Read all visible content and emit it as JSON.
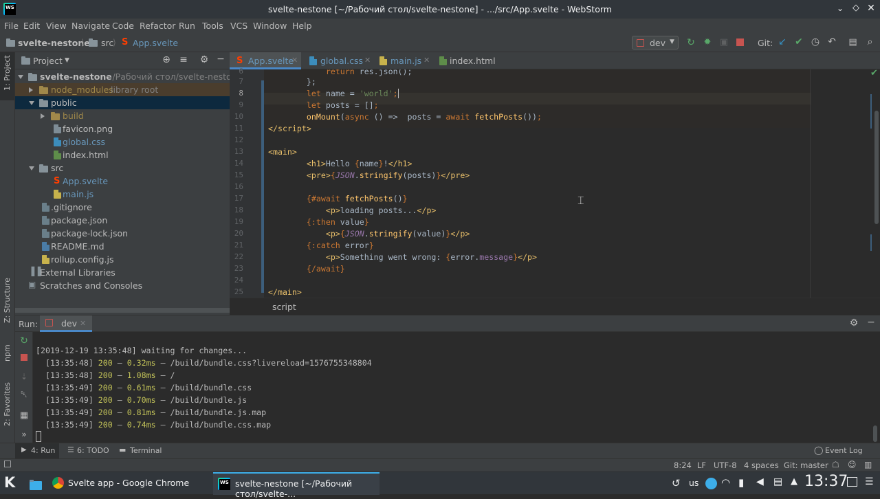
{
  "window": {
    "title": "svelte-nestone [~/Рабочий стол/svelte-nestone] - .../src/App.svelte - WebStorm"
  },
  "menu": [
    "File",
    "Edit",
    "View",
    "Navigate",
    "Code",
    "Refactor",
    "Run",
    "Tools",
    "VCS",
    "Window",
    "Help"
  ],
  "navbar": {
    "crumbs": [
      "svelte-nestone",
      "src",
      "App.svelte"
    ],
    "run_config": "dev",
    "git_label": "Git:"
  },
  "left_strip": {
    "project": "1: Project",
    "structure": "Z: Structure",
    "npm": "npm",
    "favorites": "2: Favorites"
  },
  "project_panel": {
    "title": "Project",
    "tree": [
      {
        "label": "svelte-nestone",
        "suffix": "~/Рабочий стол/svelte-nestone",
        "kind": "folder",
        "icon": "folder-icon"
      },
      {
        "label": "node_modules",
        "suffix": "library root",
        "kind": "folder",
        "icon": "folder-icon"
      },
      {
        "label": "public",
        "kind": "folder",
        "icon": "folder-icon"
      },
      {
        "label": "build",
        "kind": "folder",
        "icon": "folder-icon"
      },
      {
        "label": "favicon.png",
        "kind": "file",
        "icon": "image-file-icon"
      },
      {
        "label": "global.css",
        "kind": "file",
        "icon": "css-file-icon"
      },
      {
        "label": "index.html",
        "kind": "file",
        "icon": "html-file-icon"
      },
      {
        "label": "src",
        "kind": "folder",
        "icon": "folder-icon"
      },
      {
        "label": "App.svelte",
        "kind": "file",
        "icon": "svelte-file-icon"
      },
      {
        "label": "main.js",
        "kind": "file",
        "icon": "js-file-icon"
      },
      {
        "label": ".gitignore",
        "kind": "file",
        "icon": "text-file-icon"
      },
      {
        "label": "package.json",
        "kind": "file",
        "icon": "json-file-icon"
      },
      {
        "label": "package-lock.json",
        "kind": "file",
        "icon": "json-file-icon"
      },
      {
        "label": "README.md",
        "kind": "file",
        "icon": "md-file-icon"
      },
      {
        "label": "rollup.config.js",
        "kind": "file",
        "icon": "js-file-icon"
      },
      {
        "label": "External Libraries",
        "kind": "special",
        "icon": "library-icon"
      },
      {
        "label": "Scratches and Consoles",
        "kind": "special",
        "icon": "scratches-icon"
      }
    ]
  },
  "editor": {
    "tabs": [
      {
        "label": "App.svelte",
        "icon": "svelte-file-icon",
        "active": true
      },
      {
        "label": "global.css",
        "icon": "css-file-icon"
      },
      {
        "label": "main.js",
        "icon": "js-file-icon"
      },
      {
        "label": "index.html",
        "icon": "html-file-icon"
      }
    ],
    "line_numbers": [
      "6",
      "7",
      "8",
      "9",
      "10",
      "11",
      "12",
      "13",
      "14",
      "15",
      "16",
      "17",
      "18",
      "19",
      "20",
      "21",
      "22",
      "23",
      "24",
      "25"
    ],
    "breadcrumb": "script"
  },
  "run": {
    "label": "Run:",
    "config": "dev",
    "output": [
      {
        "time": "[2019-12-19 13:35:48] waiting for changes..."
      },
      {
        "time": "[13:35:48]",
        "code": "200",
        "sep": "–",
        "ms": "0.32ms",
        "sep2": "–",
        "path": "/build/bundle.css?livereload=1576755348804"
      },
      {
        "time": "[13:35:48]",
        "code": "200",
        "sep": "–",
        "ms": "1.08ms",
        "sep2": "–",
        "path": "/"
      },
      {
        "time": "[13:35:49]",
        "code": "200",
        "sep": "–",
        "ms": "0.61ms",
        "sep2": "–",
        "path": "/build/bundle.css"
      },
      {
        "time": "[13:35:49]",
        "code": "200",
        "sep": "–",
        "ms": "0.70ms",
        "sep2": "–",
        "path": "/build/bundle.js"
      },
      {
        "time": "[13:35:49]",
        "code": "200",
        "sep": "–",
        "ms": "0.81ms",
        "sep2": "–",
        "path": "/build/bundle.js.map"
      },
      {
        "time": "[13:35:49]",
        "code": "200",
        "sep": "–",
        "ms": "0.74ms",
        "sep2": "–",
        "path": "/build/bundle.css.map"
      }
    ]
  },
  "bottom_tabs": [
    {
      "label": "4: Run"
    },
    {
      "label": "6: TODO"
    },
    {
      "label": "Terminal"
    }
  ],
  "event_log": "Event Log",
  "status": {
    "position": "8:24",
    "line_sep": "LF",
    "encoding": "UTF-8",
    "indent": "4 spaces",
    "git": "Git: master"
  },
  "taskbar": {
    "chrome": "Svelte app - Google Chrome",
    "webstorm": "svelte-nestone [~/Рабочий стол/svelte-...",
    "keyboard": "us",
    "clock": "13:37"
  }
}
